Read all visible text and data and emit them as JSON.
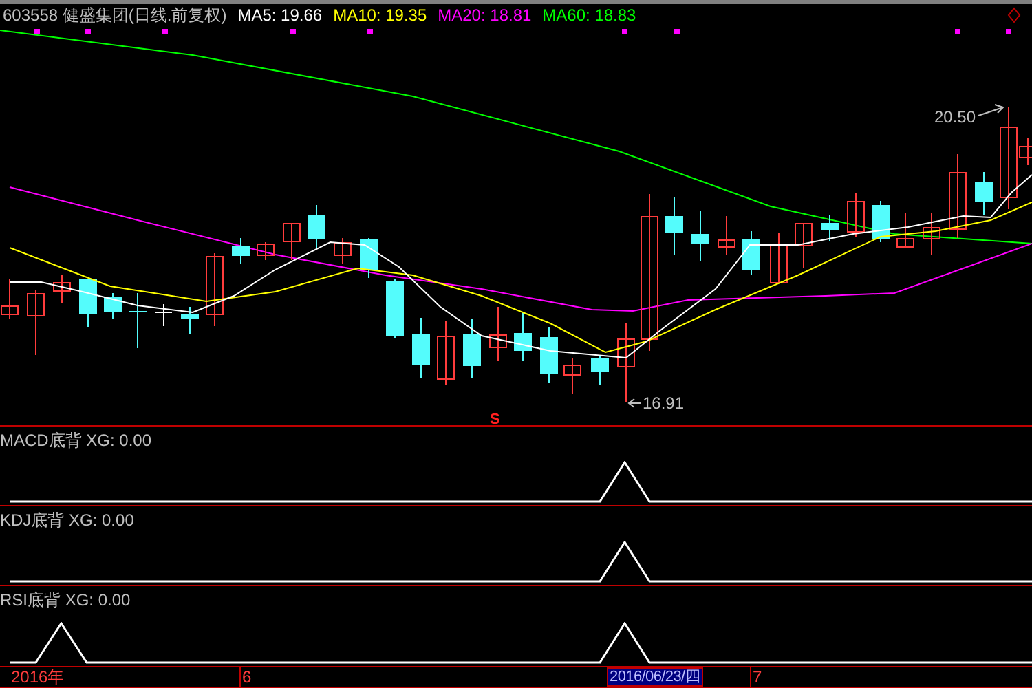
{
  "header": {
    "symbol": "603558",
    "name": "健盛集团(日线.前复权)",
    "indicators": [
      {
        "label": "MA5: 19.66",
        "color": "#ffffff"
      },
      {
        "label": "MA10: 19.35",
        "color": "#ffff00"
      },
      {
        "label": "MA20: 18.81",
        "color": "#ff00ff"
      },
      {
        "label": "MA60: 18.83",
        "color": "#00ff00"
      }
    ]
  },
  "chart": {
    "high_label": "20.50",
    "low_label": "16.91",
    "signal_mark": "S"
  },
  "panels": [
    {
      "name": "MACD底背",
      "reading": "XG: 0.00"
    },
    {
      "name": "KDJ底背",
      "reading": "XG: 0.00"
    },
    {
      "name": "RSI底背",
      "reading": "XG: 0.00"
    }
  ],
  "time_axis": [
    {
      "label": "2016年",
      "kind": "label"
    },
    {
      "label": "6",
      "kind": "tick"
    },
    {
      "label": "2016/06/23/四",
      "kind": "cursor"
    },
    {
      "label": "7",
      "kind": "tick"
    }
  ]
}
